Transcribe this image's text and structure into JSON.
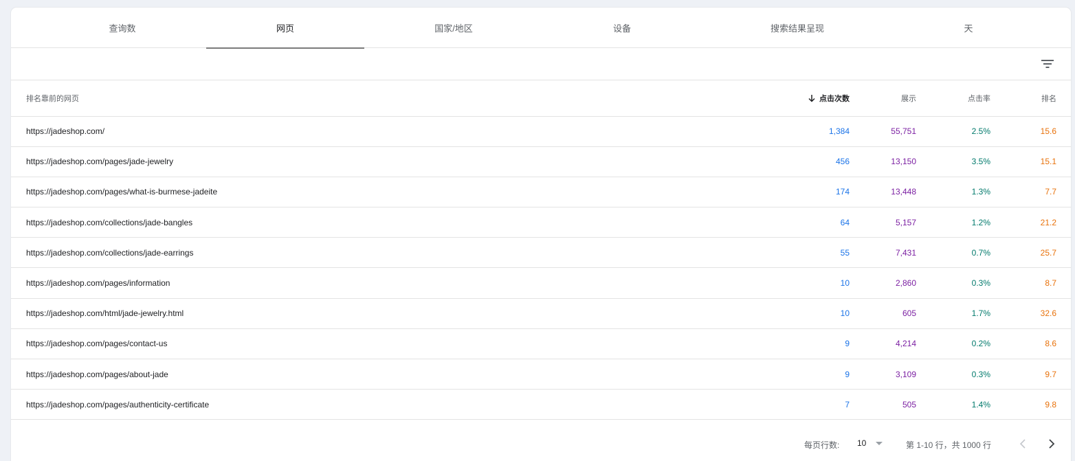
{
  "tabs": [
    "查询数",
    "网页",
    "国家/地区",
    "设备",
    "搜索结果呈现",
    "天"
  ],
  "active_tab": "网页",
  "table": {
    "headers": {
      "page": "排名靠前的网页",
      "clicks": "点击次数",
      "impressions": "展示",
      "ctr": "点击率",
      "position": "排名"
    },
    "sorted_by": "clicks",
    "rows": [
      {
        "page": "https://jadeshop.com/",
        "clicks": "1,384",
        "impressions": "55,751",
        "ctr": "2.5%",
        "position": "15.6"
      },
      {
        "page": "https://jadeshop.com/pages/jade-jewelry",
        "clicks": "456",
        "impressions": "13,150",
        "ctr": "3.5%",
        "position": "15.1"
      },
      {
        "page": "https://jadeshop.com/pages/what-is-burmese-jadeite",
        "clicks": "174",
        "impressions": "13,448",
        "ctr": "1.3%",
        "position": "7.7"
      },
      {
        "page": "https://jadeshop.com/collections/jade-bangles",
        "clicks": "64",
        "impressions": "5,157",
        "ctr": "1.2%",
        "position": "21.2"
      },
      {
        "page": "https://jadeshop.com/collections/jade-earrings",
        "clicks": "55",
        "impressions": "7,431",
        "ctr": "0.7%",
        "position": "25.7"
      },
      {
        "page": "https://jadeshop.com/pages/information",
        "clicks": "10",
        "impressions": "2,860",
        "ctr": "0.3%",
        "position": "8.7"
      },
      {
        "page": "https://jadeshop.com/html/jade-jewelry.html",
        "clicks": "10",
        "impressions": "605",
        "ctr": "1.7%",
        "position": "32.6"
      },
      {
        "page": "https://jadeshop.com/pages/contact-us",
        "clicks": "9",
        "impressions": "4,214",
        "ctr": "0.2%",
        "position": "8.6"
      },
      {
        "page": "https://jadeshop.com/pages/about-jade",
        "clicks": "9",
        "impressions": "3,109",
        "ctr": "0.3%",
        "position": "9.7"
      },
      {
        "page": "https://jadeshop.com/pages/authenticity-certificate",
        "clicks": "7",
        "impressions": "505",
        "ctr": "1.4%",
        "position": "9.8"
      }
    ]
  },
  "pagination": {
    "rows_per_page_label": "每页行数:",
    "rows_per_page": "10",
    "range_text": "第 1-10 行，共 1000 行"
  },
  "colors": {
    "clicks": "#1a73e8",
    "impressions": "#7b1fa2",
    "ctr": "#00796b",
    "position": "#e8710a"
  },
  "icons": [
    "filter-icon",
    "arrow-down-icon",
    "chevron-left-icon",
    "chevron-right-icon",
    "dropdown-caret-icon"
  ]
}
